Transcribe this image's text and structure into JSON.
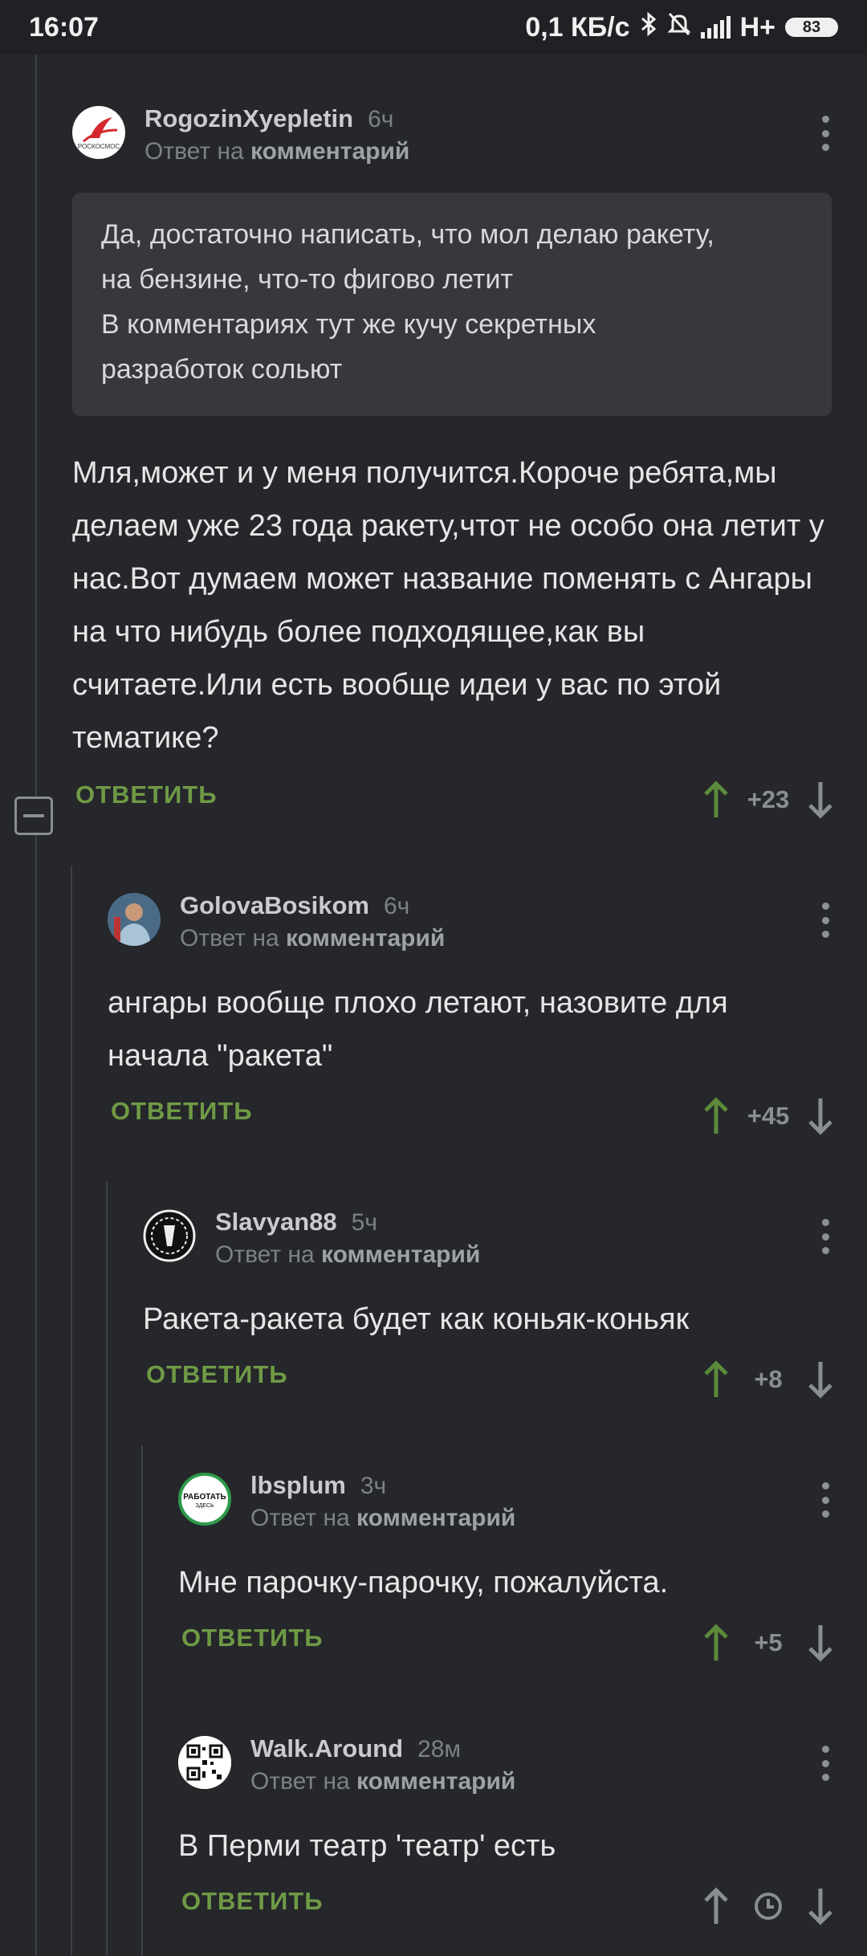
{
  "status_bar": {
    "time": "16:07",
    "speed": "0,1 КБ/с",
    "network": "H+",
    "battery": "83",
    "icons": [
      "bluetooth-icon",
      "mute-icon",
      "signal-icon",
      "battery-icon"
    ]
  },
  "colors": {
    "background": "#25272b",
    "reply_green": "#6f9a45",
    "upvote_green": "#5c8a3a",
    "muted_text": "#7d8086"
  },
  "comments": [
    {
      "author": "RogozinXyepletin",
      "time": "6ч",
      "reply_prefix": "Ответ на",
      "reply_target": "комментарий",
      "avatar_label": "РОСКОСМОС",
      "quote": [
        "Да, достаточно написать, что мол делаю ракету,",
        "на бензине, что-то фигово летит",
        "В комментариях тут же кучу секретных",
        "разработок сольют"
      ],
      "text": "Мля,может и у меня получится.Короче ребята,мы делаем уже 23 года ракету,чтот не особо она летит у нас.Вот думаем может название поменять с Ангары на что нибудь более подходящее,как вы считаете.Или есть вообще идеи у вас по этой тематике?",
      "reply_label": "ОТВЕТИТЬ",
      "score": "+23"
    },
    {
      "author": "GolovaBosikom",
      "time": "6ч",
      "reply_prefix": "Ответ на",
      "reply_target": "комментарий",
      "text": "ангары вообще плохо летают, назовите для начала \"ракета\"",
      "reply_label": "ОТВЕТИТЬ",
      "score": "+45"
    },
    {
      "author": "Slavyan88",
      "time": "5ч",
      "reply_prefix": "Ответ на",
      "reply_target": "комментарий",
      "text": "Ракета-ракета будет как коньяк-коньяк",
      "reply_label": "ОТВЕТИТЬ",
      "score": "+8"
    },
    {
      "author": "lbsplum",
      "time": "3ч",
      "reply_prefix": "Ответ на",
      "reply_target": "комментарий",
      "avatar_label_top": "РАБОТАТЬ",
      "avatar_label_bottom": "ЗДЕСЬ",
      "text": "Мне парочку-парочку, пожалуйста.",
      "reply_label": "ОТВЕТИТЬ",
      "score": "+5"
    },
    {
      "author": "Walk.Around",
      "time": "28м",
      "reply_prefix": "Ответ на",
      "reply_target": "комментарий",
      "text": "В Перми театр 'театр' есть",
      "reply_label": "ОТВЕТИТЬ",
      "score_hidden_icon": "clock-icon"
    }
  ]
}
